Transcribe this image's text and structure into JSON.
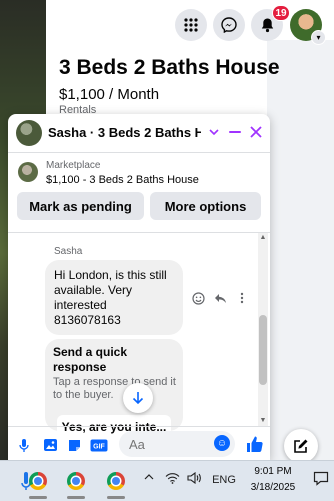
{
  "topbar": {
    "notifications_count": "19"
  },
  "listing": {
    "title": "3 Beds 2 Baths House",
    "price": "$1,100 / Month",
    "category": "Rentals"
  },
  "chat": {
    "header_title": "Sasha · 3 Beds 2 Baths Ho...",
    "marketplace_label": "Marketplace",
    "marketplace_item": "$1,100 - 3 Beds 2 Baths House",
    "actions": {
      "mark_pending": "Mark as pending",
      "more_options": "More options"
    },
    "sender_name": "Sasha",
    "message": "Hi London, is this still available.    Very interested\n8136078163",
    "quick_response": {
      "title": "Send a quick response",
      "subtitle": "Tap a response to send it to the buyer.",
      "option": "Yes, are you inte..."
    },
    "composer": {
      "placeholder": "Aa"
    }
  },
  "taskbar": {
    "language": "ENG",
    "time": "9:01 PM",
    "date": "3/18/2025"
  },
  "colors": {
    "accent": "#0866ff",
    "chat_controls": "#a033ff",
    "badge": "#e41e3f"
  },
  "icons": [
    "apps-grid-icon",
    "messenger-icon",
    "bell-icon",
    "minimize-icon",
    "close-icon",
    "chevron-down-icon",
    "arrow-down-icon",
    "microphone-icon",
    "image-icon",
    "sticker-icon",
    "gif-icon",
    "emoji-icon",
    "like-icon",
    "compose-icon",
    "chrome-icon"
  ]
}
